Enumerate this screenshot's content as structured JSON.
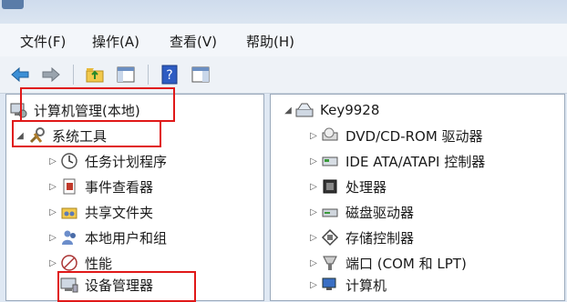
{
  "menu": [
    {
      "label": "文件(F)"
    },
    {
      "label": "操作(A)"
    },
    {
      "label": "查看(V)"
    },
    {
      "label": "帮助(H)"
    }
  ],
  "toolbar": {
    "icons": [
      "back-icon",
      "forward-icon",
      "up-folder-icon",
      "show-hide-tree-icon",
      "help-icon",
      "properties-icon"
    ]
  },
  "tree": {
    "root_label": "计算机管理(本地)",
    "system_tools_label": "系统工具",
    "items": [
      {
        "label": "任务计划程序",
        "icon": "clock-icon"
      },
      {
        "label": "事件查看器",
        "icon": "event-viewer-icon"
      },
      {
        "label": "共享文件夹",
        "icon": "shared-folder-icon"
      },
      {
        "label": "本地用户和组",
        "icon": "users-icon"
      },
      {
        "label": "性能",
        "icon": "performance-icon"
      },
      {
        "label": "设备管理器",
        "icon": "device-manager-icon"
      }
    ]
  },
  "devices": {
    "computer_name": "Key9928",
    "items": [
      {
        "label": "DVD/CD-ROM 驱动器",
        "icon": "dvd-drive-icon"
      },
      {
        "label": "IDE ATA/ATAPI 控制器",
        "icon": "ide-controller-icon"
      },
      {
        "label": "处理器",
        "icon": "processor-icon"
      },
      {
        "label": "磁盘驱动器",
        "icon": "disk-drive-icon"
      },
      {
        "label": "存储控制器",
        "icon": "storage-controller-icon"
      },
      {
        "label": "端口 (COM 和 LPT)",
        "icon": "port-icon"
      },
      {
        "label": "计算机",
        "icon": "computer-icon"
      }
    ]
  },
  "colors": {
    "highlight": "#e01818",
    "selection": "#e01818"
  }
}
